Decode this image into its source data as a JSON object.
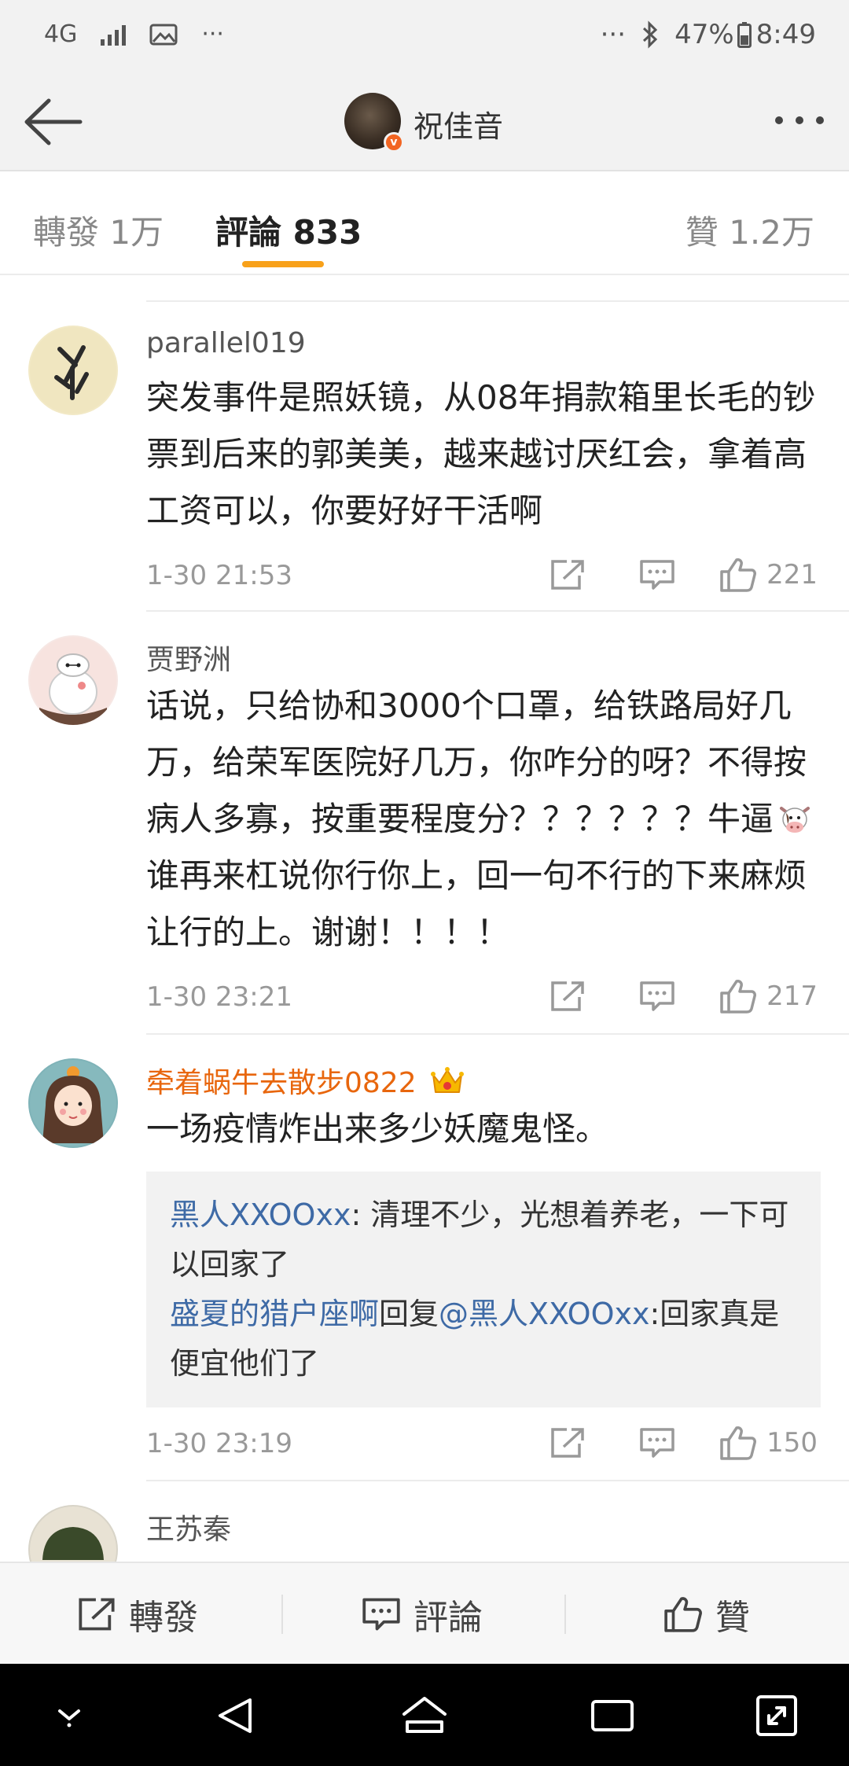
{
  "status_bar": {
    "network": "4G",
    "more": "···",
    "right_more": "···",
    "battery": "47%",
    "time": "8:49"
  },
  "nav": {
    "title": "祝佳音",
    "verified_badge": "v"
  },
  "tabs": [
    {
      "label": "轉發 1万"
    },
    {
      "label": "評論 833"
    },
    {
      "label": "贊 1.2万"
    }
  ],
  "comments": [
    {
      "username": "parallel019",
      "text": "突发事件是照妖镜，从08年捐款箱里长毛的钞票到后来的郭美美，越来越讨厌红会，拿着高工资可以，你要好好干活啊",
      "time": "1-30 21:53",
      "likes": "221"
    },
    {
      "username": "贾野洲",
      "text_part1": "话说，只给协和3000个口罩，给铁路局好几万，给荣军医院好几万，你咋分的呀？不得按病人多寡，按重要程度分？？？？？？牛逼",
      "text_part2": "谁再来杠说你行你上，回一句不行的下来麻烦让行的上。谢谢！！！！",
      "time": "1-30 23:21",
      "likes": "217"
    },
    {
      "username": "牵着蜗牛去散步0822",
      "text": "一场疫情炸出来多少妖魔鬼怪。",
      "replies": [
        {
          "user": "黑人XXOOxx",
          "sep": ":",
          "text": " 清理不少，光想着养老，一下可以回家了"
        },
        {
          "user": "盛夏的猎户座啊",
          "mid": "回复",
          "mention": "@黑人XXOOxx",
          "text": ":回家真是便宜他们了"
        }
      ],
      "time": "1-30 23:19",
      "likes": "150"
    },
    {
      "username": "王苏秦"
    }
  ],
  "bottom_bar": {
    "repost": "轉發",
    "comment": "評論",
    "like": "贊"
  },
  "colors": {
    "accent": "#f8a11a",
    "vip_name": "#e8660d",
    "link": "#3e6aa6",
    "verified": "#f26522"
  }
}
